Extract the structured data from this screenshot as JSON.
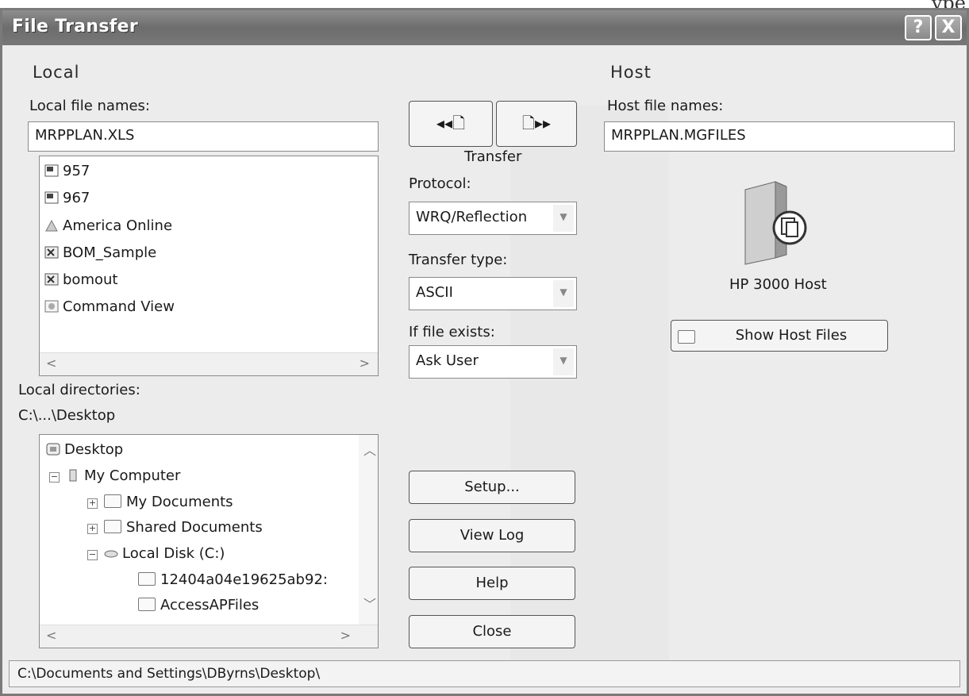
{
  "corner_text": "ype",
  "window": {
    "title": "File Transfer",
    "help_glyph": "?",
    "close_glyph": "X"
  },
  "local": {
    "section": "Local",
    "file_names_label": "Local file names:",
    "file_name_value": "MRPPLAN.XLS",
    "files": [
      {
        "name": "957",
        "icon": "hp-document-icon"
      },
      {
        "name": "967",
        "icon": "hp-document-icon"
      },
      {
        "name": "America Online",
        "icon": "aol-shortcut-icon"
      },
      {
        "name": "BOM_Sample",
        "icon": "excel-file-icon"
      },
      {
        "name": "bomout",
        "icon": "excel-file-icon"
      },
      {
        "name": "Command View",
        "icon": "app-shortcut-icon"
      }
    ],
    "directories_label": "Local directories:",
    "current_directory": "C:\\...\\Desktop",
    "tree": [
      {
        "label": "Desktop",
        "level": 0
      },
      {
        "label": "My Computer",
        "level": 1,
        "expander": "−"
      },
      {
        "label": "My Documents",
        "level": 2,
        "expander": "+"
      },
      {
        "label": "Shared Documents",
        "level": 2,
        "expander": "+"
      },
      {
        "label": "Local Disk (C:)",
        "level": 2,
        "expander": "−"
      },
      {
        "label": "12404a04e19625ab92:",
        "level": 3
      },
      {
        "label": "AccessAPFiles",
        "level": 3
      }
    ]
  },
  "transfer": {
    "receive_glyph": "◂◂🗋",
    "send_glyph": "🗋▸▸",
    "label": "Transfer",
    "protocol_label": "Protocol:",
    "protocol_value": "WRQ/Reflection",
    "type_label": "Transfer type:",
    "type_value": "ASCII",
    "exists_label": "If file exists:",
    "exists_value": "Ask User"
  },
  "buttons": {
    "setup": "Setup...",
    "view_log": "View Log",
    "help": "Help",
    "close": "Close"
  },
  "host": {
    "section": "Host",
    "file_names_label": "Host file names:",
    "file_name_value": "MRPPLAN.MGFILES",
    "host_name": "HP 3000 Host",
    "show_files": "Show Host Files"
  },
  "status_path": "C:\\Documents and Settings\\DByrns\\Desktop\\"
}
